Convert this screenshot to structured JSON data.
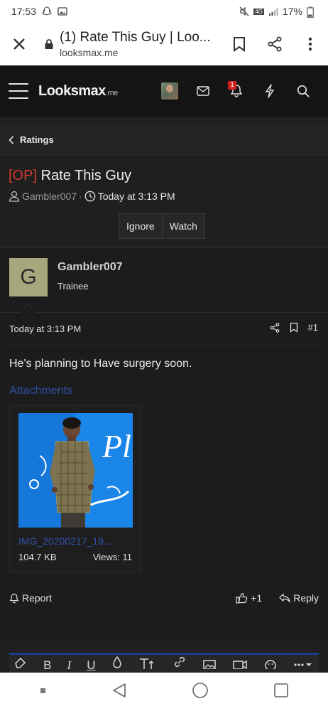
{
  "status_bar": {
    "time": "17:53",
    "battery": "17%",
    "network": "4G"
  },
  "browser": {
    "tab_title": "(1) Rate This Guy | Loo...",
    "url": "looksmax.me"
  },
  "site": {
    "logo_main": "Lοοksmax",
    "logo_suffix": ".me",
    "notification_count": "1"
  },
  "breadcrumb": {
    "label": "Ratings"
  },
  "thread": {
    "prefix": "[OP]",
    "title": "Rate This Guy",
    "author": "Gambler007",
    "separator": "·",
    "time": "Today at 3:13 PM",
    "ignore_label": "Ignore",
    "watch_label": "Watch"
  },
  "post": {
    "avatar_letter": "G",
    "username": "Gambler007",
    "user_title": "Trainee",
    "date": "Today at 3:13 PM",
    "number": "#1",
    "body": "He's planning to Have surgery soon.",
    "attachments_label": "Attachments",
    "attachment": {
      "name": "IMG_20200217_19...",
      "size": "104.7 KB",
      "views": "Views: 11"
    },
    "report_label": "Report",
    "like_count": "+1",
    "reply_label": "Reply"
  },
  "editor": {
    "bold": "B",
    "italic": "I",
    "underline": "U"
  }
}
